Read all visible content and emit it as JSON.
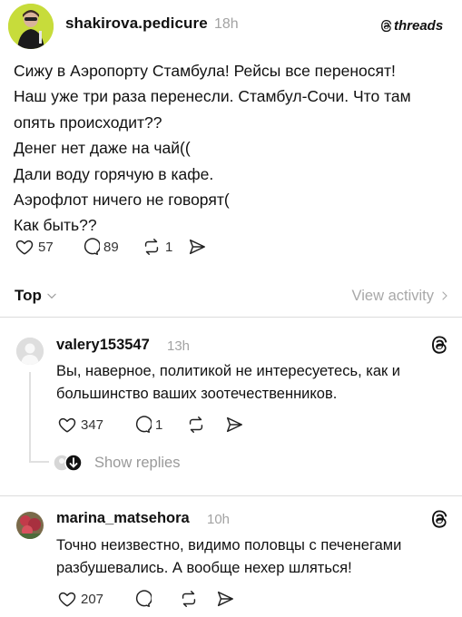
{
  "post": {
    "username": "shakirova.pedicure",
    "time": "18h",
    "brand": "threads",
    "lines": [
      "Сижу в Аэропорту Стамбула! Рейсы все переносят!",
      "Наш уже три раза перенесли. Стамбул-Сочи. Что там",
      "опять происходит??",
      "Денег нет даже на чай((",
      "Дали воду горячую в кафе.",
      "Аэрофлот ничего не говорят(",
      "Как быть??"
    ],
    "likes": "57",
    "replies": "89",
    "reposts": "1",
    "icons": [
      "heart-icon",
      "comment-icon",
      "repost-icon",
      "share-icon"
    ]
  },
  "sort": {
    "label": "Top",
    "view_activity": "View activity"
  },
  "comments": [
    {
      "username": "valery153547",
      "time": "13h",
      "lines": [
        "Вы, наверное, политикой не интересуетесь, как и",
        "большинство ваших зоотечественников."
      ],
      "likes": "347",
      "replies": "1",
      "show_replies": "Show replies"
    },
    {
      "username": "marina_matsehora",
      "time": "10h",
      "lines": [
        "Точно неизвестно, видимо половцы с печенегами",
        "разбушевались. А вообще нехер шляться!"
      ],
      "likes": "207"
    }
  ],
  "colors": {
    "text": "#111111",
    "muted": "#a3a3a3",
    "avatar_bg": "#c7dc3b",
    "divider": "#dcdcdc"
  }
}
